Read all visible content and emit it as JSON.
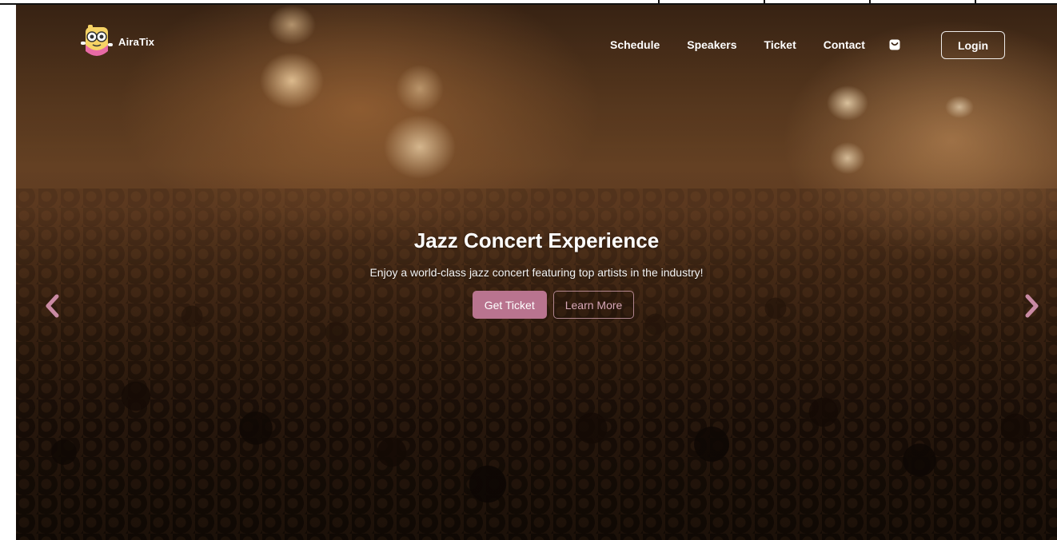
{
  "brand": {
    "name": "AiraTix",
    "logo_icon": "mascot-logo-icon"
  },
  "nav": {
    "links": [
      {
        "label": "Schedule"
      },
      {
        "label": "Speakers"
      },
      {
        "label": "Ticket"
      },
      {
        "label": "Contact"
      }
    ],
    "cart_icon": "shopping-bag-icon",
    "login_label": "Login"
  },
  "hero": {
    "title": "Jazz Concert Experience",
    "subtitle": "Enjoy a world-class jazz concert featuring top artists in the industry!",
    "primary_cta": "Get Ticket",
    "secondary_cta": "Learn More",
    "prev_icon": "chevron-left-icon",
    "next_icon": "chevron-right-icon"
  },
  "colors": {
    "accent": "#b9748f",
    "arrow": "#c98aa3",
    "text": "#ffffff"
  }
}
